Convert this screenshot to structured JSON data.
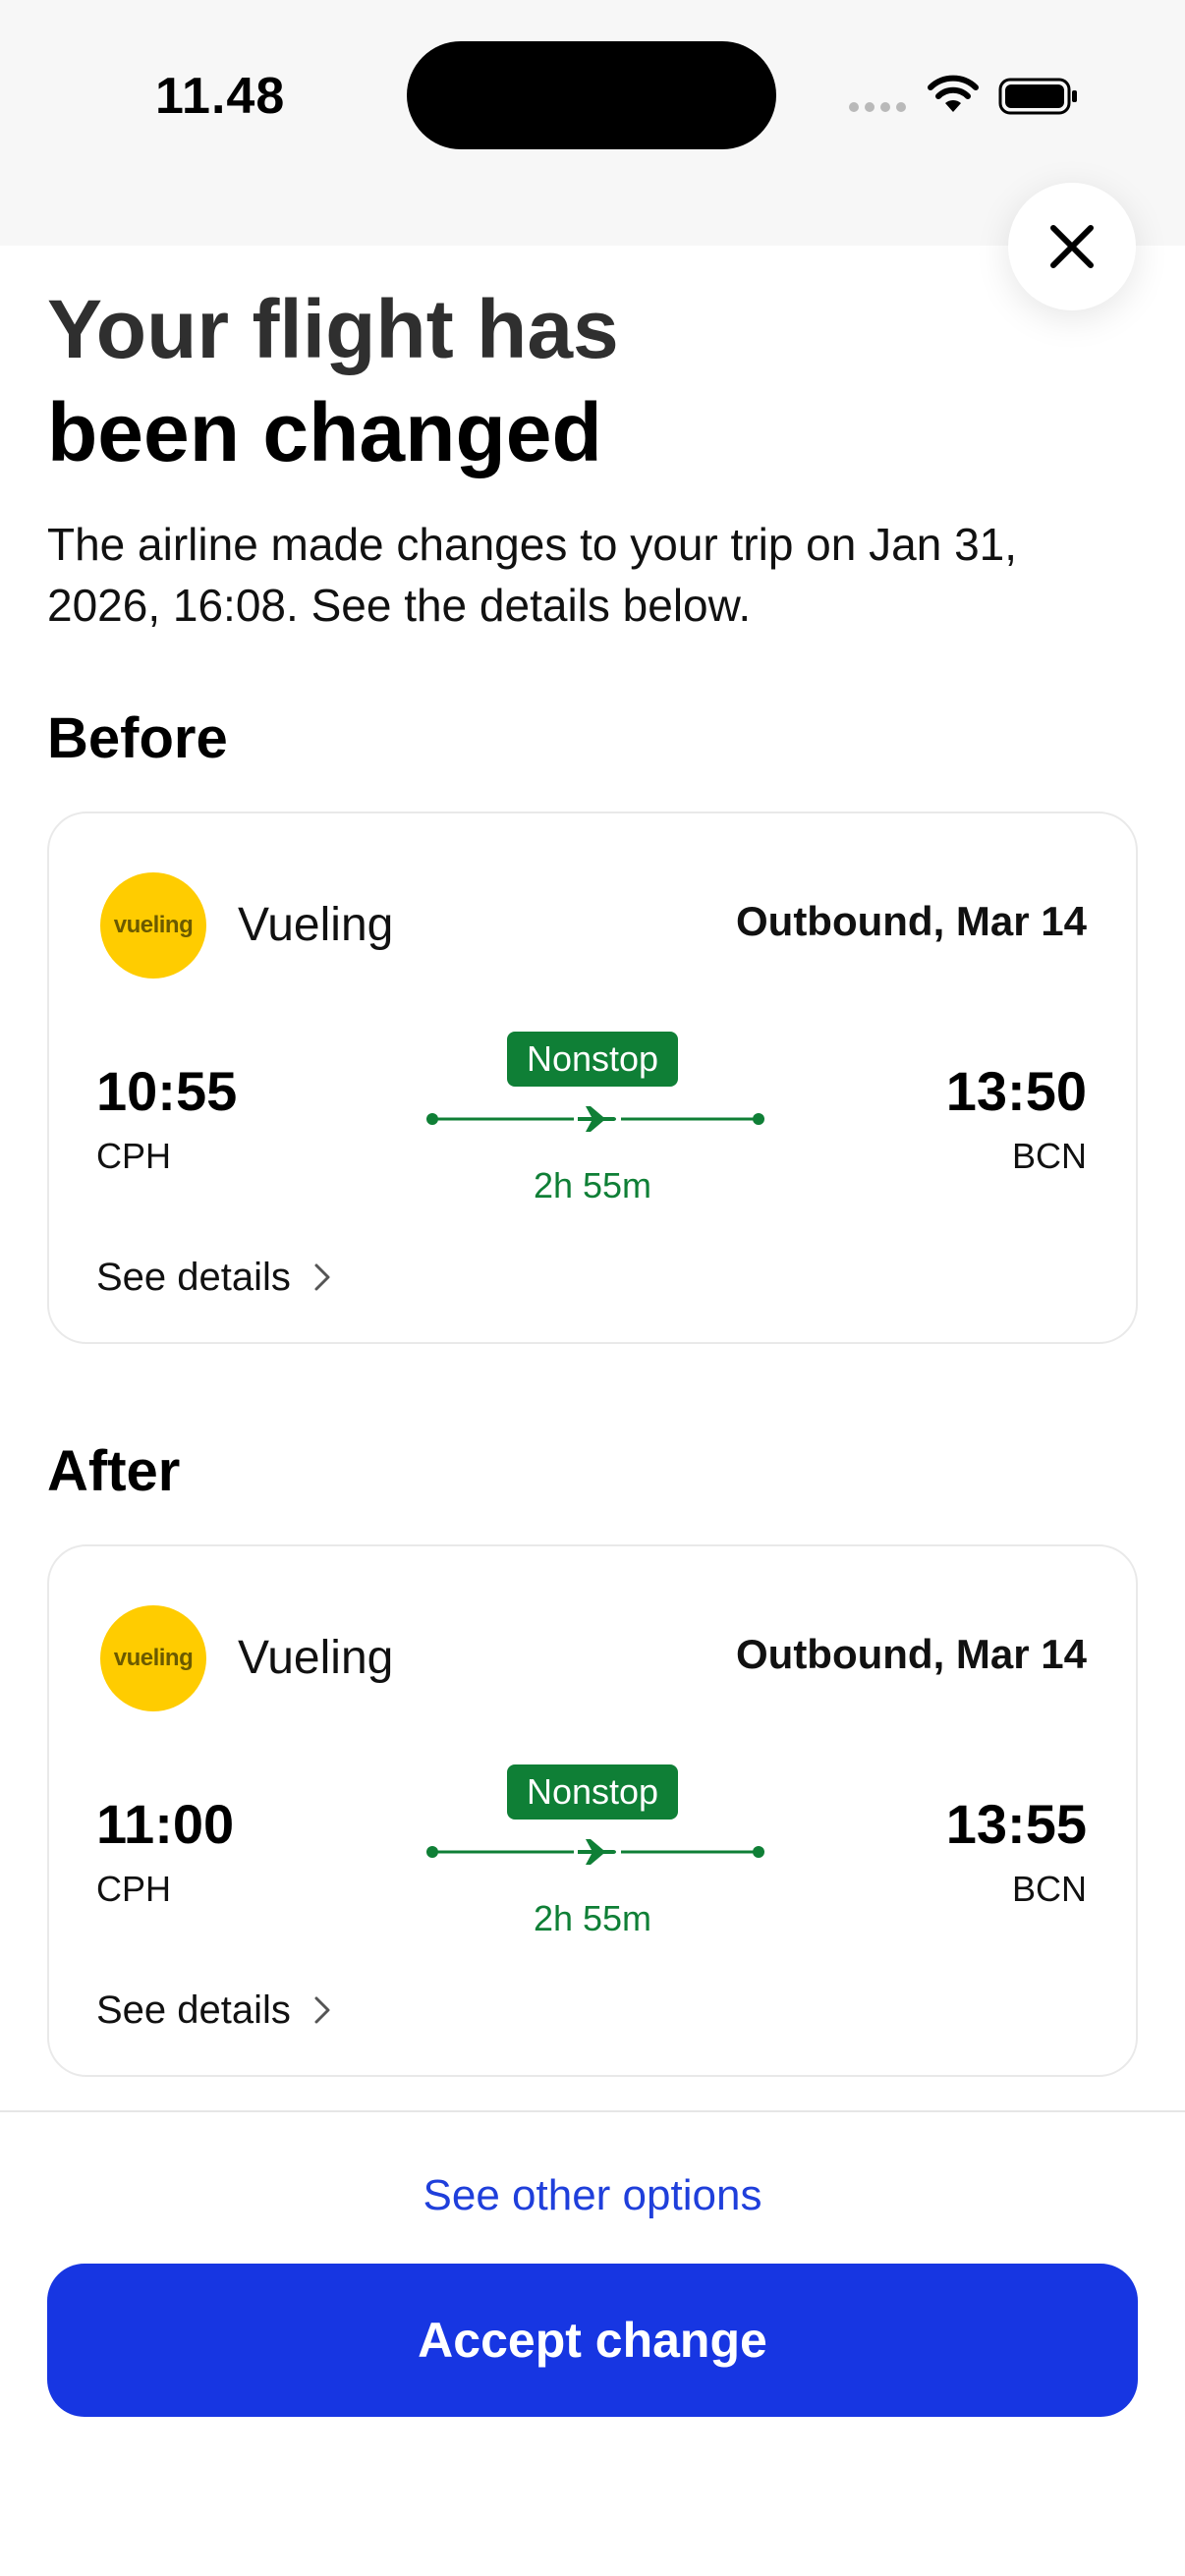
{
  "status_bar": {
    "time": "11.48"
  },
  "header": {
    "title_line1": "Your flight has",
    "title_line2": "been changed",
    "subtitle": "The airline made changes to your trip on Jan 31, 2026, 16:08. See the details below."
  },
  "before": {
    "heading": "Before",
    "airline": "Vueling",
    "logo_text": "vueling",
    "leg_date": "Outbound, Mar 14",
    "departure_time": "10:55",
    "departure_code": "CPH",
    "arrival_time": "13:50",
    "arrival_code": "BCN",
    "stops": "Nonstop",
    "duration": "2h 55m",
    "details_label": "See details"
  },
  "after": {
    "heading": "After",
    "airline": "Vueling",
    "logo_text": "vueling",
    "leg_date": "Outbound, Mar 14",
    "departure_time": "11:00",
    "departure_code": "CPH",
    "arrival_time": "13:55",
    "arrival_code": "BCN",
    "stops": "Nonstop",
    "duration": "2h 55m",
    "details_label": "See details"
  },
  "footer": {
    "other_options_label": "See other options",
    "accept_label": "Accept change"
  },
  "colors": {
    "primary": "#1736e2",
    "link": "#1f3fdb",
    "success": "#0f7f36",
    "vueling_yellow": "#ffcc00"
  },
  "icons": [
    "wifi-icon",
    "battery-icon",
    "close-icon",
    "plane-icon",
    "chevron-right-icon"
  ]
}
